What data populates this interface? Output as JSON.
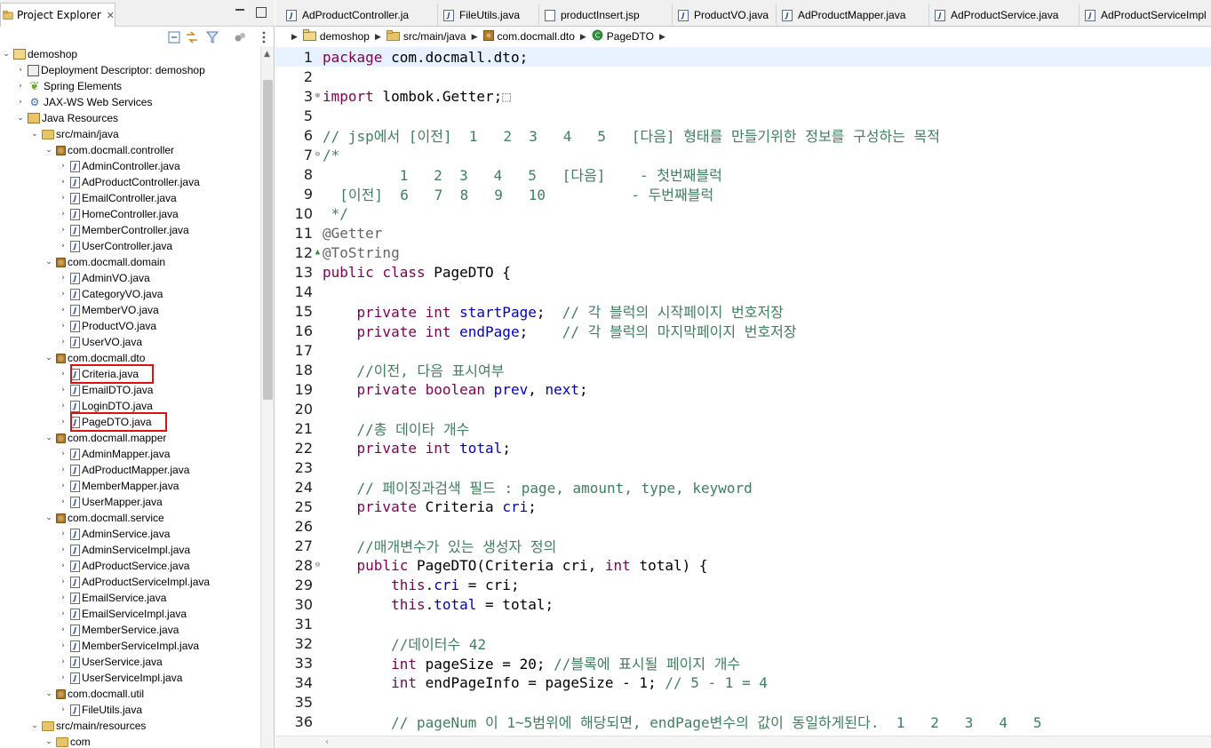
{
  "explorer": {
    "tab_label": "Project Explorer",
    "tab_close": "✕",
    "tree": [
      {
        "label": "demoshop",
        "depth": 0,
        "arrow": "⌄",
        "icon": "project-icon"
      },
      {
        "label": "Deployment Descriptor: demoshop",
        "depth": 1,
        "arrow": "›",
        "icon": "deployment-descriptor-icon"
      },
      {
        "label": "Spring Elements",
        "depth": 1,
        "arrow": "›",
        "icon": "spring-icon"
      },
      {
        "label": "JAX-WS Web Services",
        "depth": 1,
        "arrow": "›",
        "icon": "web-services-icon"
      },
      {
        "label": "Java Resources",
        "depth": 1,
        "arrow": "⌄",
        "icon": "java-resources-icon"
      },
      {
        "label": "src/main/java",
        "depth": 2,
        "arrow": "⌄",
        "icon": "source-folder-icon"
      },
      {
        "label": "com.docmall.controller",
        "depth": 3,
        "arrow": "⌄",
        "icon": "package-icon"
      },
      {
        "label": "AdminController.java",
        "depth": 4,
        "arrow": "›",
        "icon": "java-file-icon"
      },
      {
        "label": "AdProductController.java",
        "depth": 4,
        "arrow": "›",
        "icon": "java-file-icon"
      },
      {
        "label": "EmailController.java",
        "depth": 4,
        "arrow": "›",
        "icon": "java-file-icon"
      },
      {
        "label": "HomeController.java",
        "depth": 4,
        "arrow": "›",
        "icon": "java-file-icon"
      },
      {
        "label": "MemberController.java",
        "depth": 4,
        "arrow": "›",
        "icon": "java-file-icon"
      },
      {
        "label": "UserController.java",
        "depth": 4,
        "arrow": "›",
        "icon": "java-file-icon"
      },
      {
        "label": "com.docmall.domain",
        "depth": 3,
        "arrow": "⌄",
        "icon": "package-icon"
      },
      {
        "label": "AdminVO.java",
        "depth": 4,
        "arrow": "›",
        "icon": "java-file-icon"
      },
      {
        "label": "CategoryVO.java",
        "depth": 4,
        "arrow": "›",
        "icon": "java-file-icon"
      },
      {
        "label": "MemberVO.java",
        "depth": 4,
        "arrow": "›",
        "icon": "java-file-icon"
      },
      {
        "label": "ProductVO.java",
        "depth": 4,
        "arrow": "›",
        "icon": "java-file-icon"
      },
      {
        "label": "UserVO.java",
        "depth": 4,
        "arrow": "›",
        "icon": "java-file-icon"
      },
      {
        "label": "com.docmall.dto",
        "depth": 3,
        "arrow": "⌄",
        "icon": "package-icon"
      },
      {
        "label": "Criteria.java",
        "depth": 4,
        "arrow": "›",
        "icon": "java-file-icon",
        "highlight": true
      },
      {
        "label": "EmailDTO.java",
        "depth": 4,
        "arrow": "›",
        "icon": "java-file-icon"
      },
      {
        "label": "LoginDTO.java",
        "depth": 4,
        "arrow": "›",
        "icon": "java-file-icon"
      },
      {
        "label": "PageDTO.java",
        "depth": 4,
        "arrow": "›",
        "icon": "java-file-icon",
        "highlight": true
      },
      {
        "label": "com.docmall.mapper",
        "depth": 3,
        "arrow": "⌄",
        "icon": "package-icon"
      },
      {
        "label": "AdminMapper.java",
        "depth": 4,
        "arrow": "›",
        "icon": "java-file-icon"
      },
      {
        "label": "AdProductMapper.java",
        "depth": 4,
        "arrow": "›",
        "icon": "java-file-icon"
      },
      {
        "label": "MemberMapper.java",
        "depth": 4,
        "arrow": "›",
        "icon": "java-file-icon"
      },
      {
        "label": "UserMapper.java",
        "depth": 4,
        "arrow": "›",
        "icon": "java-file-icon"
      },
      {
        "label": "com.docmall.service",
        "depth": 3,
        "arrow": "⌄",
        "icon": "package-icon"
      },
      {
        "label": "AdminService.java",
        "depth": 4,
        "arrow": "›",
        "icon": "java-file-icon"
      },
      {
        "label": "AdminServiceImpl.java",
        "depth": 4,
        "arrow": "›",
        "icon": "java-file-icon"
      },
      {
        "label": "AdProductService.java",
        "depth": 4,
        "arrow": "›",
        "icon": "java-file-icon"
      },
      {
        "label": "AdProductServiceImpl.java",
        "depth": 4,
        "arrow": "›",
        "icon": "java-file-icon"
      },
      {
        "label": "EmailService.java",
        "depth": 4,
        "arrow": "›",
        "icon": "java-file-icon"
      },
      {
        "label": "EmailServiceImpl.java",
        "depth": 4,
        "arrow": "›",
        "icon": "java-file-icon"
      },
      {
        "label": "MemberService.java",
        "depth": 4,
        "arrow": "›",
        "icon": "java-file-icon"
      },
      {
        "label": "MemberServiceImpl.java",
        "depth": 4,
        "arrow": "›",
        "icon": "java-file-icon"
      },
      {
        "label": "UserService.java",
        "depth": 4,
        "arrow": "›",
        "icon": "java-file-icon"
      },
      {
        "label": "UserServiceImpl.java",
        "depth": 4,
        "arrow": "›",
        "icon": "java-file-icon"
      },
      {
        "label": "com.docmall.util",
        "depth": 3,
        "arrow": "⌄",
        "icon": "package-icon"
      },
      {
        "label": "FileUtils.java",
        "depth": 4,
        "arrow": "›",
        "icon": "java-file-icon"
      },
      {
        "label": "src/main/resources",
        "depth": 2,
        "arrow": "⌄",
        "icon": "source-folder-icon"
      },
      {
        "label": "com",
        "depth": 3,
        "arrow": "⌄",
        "icon": "folder-icon"
      }
    ]
  },
  "editor": {
    "tabs": [
      {
        "label": "AdProductController.ja",
        "icon": "java-file-icon"
      },
      {
        "label": "FileUtils.java",
        "icon": "java-file-icon"
      },
      {
        "label": "productInsert.jsp",
        "icon": "jsp-file-icon"
      },
      {
        "label": "ProductVO.java",
        "icon": "java-file-icon"
      },
      {
        "label": "AdProductMapper.java",
        "icon": "java-file-icon"
      },
      {
        "label": "AdProductService.java",
        "icon": "java-file-icon"
      },
      {
        "label": "AdProductServiceImpl",
        "icon": "java-file-icon"
      }
    ],
    "breadcrumb": [
      "demoshop",
      "src/main/java",
      "com.docmall.dto",
      "PageDTO"
    ],
    "lines": [
      {
        "n": "1",
        "fold": "",
        "cur": true,
        "segs": [
          [
            "kw",
            "package"
          ],
          [
            "",
            "com.docmall.dto;"
          ]
        ]
      },
      {
        "n": "2",
        "fold": "",
        "segs": []
      },
      {
        "n": "3",
        "fold": "⊕",
        "segs": [
          [
            "kw",
            "import"
          ],
          [
            "",
            "lombok.Getter;"
          ],
          [
            "an",
            "⬚"
          ]
        ]
      },
      {
        "n": "5",
        "fold": "",
        "segs": []
      },
      {
        "n": "6",
        "fold": "",
        "segs": [
          [
            "cm",
            "// jsp에서 [이전]  1   2  3   4   5   [다음] 형태를 만들기위한 정보를 구성하는 목적"
          ]
        ]
      },
      {
        "n": "7",
        "fold": "⊖",
        "segs": [
          [
            "cm",
            "/*"
          ]
        ]
      },
      {
        "n": "8",
        "fold": "",
        "segs": [
          [
            "cm",
            "         1   2  3   4   5   [다음]    - 첫번째블럭"
          ]
        ]
      },
      {
        "n": "9",
        "fold": "",
        "segs": [
          [
            "cm",
            "  [이전]  6   7  8   9   10          - 두번째블럭"
          ]
        ]
      },
      {
        "n": "10",
        "fold": "",
        "segs": [
          [
            "cm",
            " */"
          ]
        ]
      },
      {
        "n": "11",
        "fold": "",
        "segs": [
          [
            "an",
            "@Getter"
          ]
        ]
      },
      {
        "n": "12",
        "fold": "▲",
        "segs": [
          [
            "an",
            "@ToString"
          ]
        ]
      },
      {
        "n": "13",
        "fold": "",
        "segs": [
          [
            "kw",
            "public class"
          ],
          [
            "",
            "PageDTO {"
          ]
        ]
      },
      {
        "n": "14",
        "fold": "",
        "segs": []
      },
      {
        "n": "15",
        "fold": "",
        "segs": [
          [
            "",
            "    "
          ],
          [
            "kw",
            "private int"
          ],
          [
            "fd",
            "startPage"
          ],
          [
            "",
            ";  "
          ],
          [
            "cm",
            "// 각 블럭의 시작페이지 번호저장"
          ]
        ]
      },
      {
        "n": "16",
        "fold": "",
        "segs": [
          [
            "",
            "    "
          ],
          [
            "kw",
            "private int"
          ],
          [
            "fd",
            "endPage"
          ],
          [
            "",
            ";    "
          ],
          [
            "cm",
            "// 각 블럭의 마지막페이지 번호저장"
          ]
        ]
      },
      {
        "n": "17",
        "fold": "",
        "segs": []
      },
      {
        "n": "18",
        "fold": "",
        "segs": [
          [
            "",
            "    "
          ],
          [
            "cm",
            "//이전, 다음 표시여부"
          ]
        ]
      },
      {
        "n": "19",
        "fold": "",
        "segs": [
          [
            "",
            "    "
          ],
          [
            "kw",
            "private boolean"
          ],
          [
            "fd",
            "prev"
          ],
          [
            "",
            ", "
          ],
          [
            "fd",
            "next"
          ],
          [
            "",
            ";"
          ]
        ]
      },
      {
        "n": "20",
        "fold": "",
        "segs": []
      },
      {
        "n": "21",
        "fold": "",
        "segs": [
          [
            "",
            "    "
          ],
          [
            "cm",
            "//총 데이타 개수"
          ]
        ]
      },
      {
        "n": "22",
        "fold": "",
        "segs": [
          [
            "",
            "    "
          ],
          [
            "kw",
            "private int"
          ],
          [
            "fd",
            "total"
          ],
          [
            "",
            ";"
          ]
        ]
      },
      {
        "n": "23",
        "fold": "",
        "segs": []
      },
      {
        "n": "24",
        "fold": "",
        "segs": [
          [
            "",
            "    "
          ],
          [
            "cm",
            "// 페이징과검색 필드 : page, amount, type, keyword"
          ]
        ]
      },
      {
        "n": "25",
        "fold": "",
        "segs": [
          [
            "",
            "    "
          ],
          [
            "kw",
            "private"
          ],
          [
            "",
            "Criteria "
          ],
          [
            "fd",
            "cri"
          ],
          [
            "",
            ";"
          ]
        ]
      },
      {
        "n": "26",
        "fold": "",
        "segs": []
      },
      {
        "n": "27",
        "fold": "",
        "segs": [
          [
            "",
            "    "
          ],
          [
            "cm",
            "//매개변수가 있는 생성자 정의"
          ]
        ]
      },
      {
        "n": "28",
        "fold": "⊖",
        "segs": [
          [
            "",
            "    "
          ],
          [
            "kw",
            "public"
          ],
          [
            "",
            "PageDTO(Criteria cri, "
          ],
          [
            "kw",
            "int"
          ],
          [
            "",
            "total) {"
          ]
        ]
      },
      {
        "n": "29",
        "fold": "",
        "segs": [
          [
            "",
            "        "
          ],
          [
            "kw",
            "this"
          ],
          [
            "",
            "."
          ],
          [
            "fd",
            "cri"
          ],
          [
            "",
            " = cri;"
          ]
        ]
      },
      {
        "n": "30",
        "fold": "",
        "segs": [
          [
            "",
            "        "
          ],
          [
            "kw",
            "this"
          ],
          [
            "",
            "."
          ],
          [
            "fd",
            "total"
          ],
          [
            "",
            " = total;"
          ]
        ]
      },
      {
        "n": "31",
        "fold": "",
        "segs": []
      },
      {
        "n": "32",
        "fold": "",
        "segs": [
          [
            "",
            "        "
          ],
          [
            "cm",
            "//데이터수 42"
          ]
        ]
      },
      {
        "n": "33",
        "fold": "",
        "segs": [
          [
            "",
            "        "
          ],
          [
            "kw",
            "int"
          ],
          [
            "",
            "pageSize = 20; "
          ],
          [
            "cm",
            "//블록에 표시될 페이지 개수"
          ]
        ]
      },
      {
        "n": "34",
        "fold": "",
        "segs": [
          [
            "",
            "        "
          ],
          [
            "kw",
            "int"
          ],
          [
            "",
            "endPageInfo = pageSize - 1; "
          ],
          [
            "cm",
            "// 5 - 1 = 4"
          ]
        ]
      },
      {
        "n": "35",
        "fold": "",
        "segs": []
      },
      {
        "n": "36",
        "fold": "",
        "segs": [
          [
            "",
            "        "
          ],
          [
            "cm",
            "// pageNum 이 1~5범위에 해당되면, endPage변수의 값이 동일하게된다.  1   2   3   4   5"
          ]
        ]
      }
    ]
  },
  "colors": {
    "keyword": "#7f0055",
    "comment": "#3f7f5f",
    "field": "#0000c0",
    "annotation": "#646464",
    "highlight_box": "#e01010",
    "current_line": "#e8f2fe"
  }
}
